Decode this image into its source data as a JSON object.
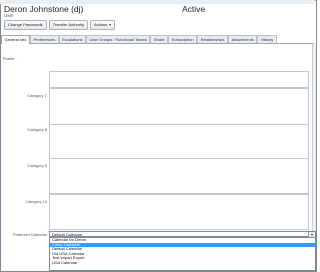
{
  "header": {
    "name": "Deron Johnstone (dj)",
    "role": "User",
    "status": "Active"
  },
  "toolbar": {
    "buttons": [
      {
        "label": "Change Passwords"
      },
      {
        "label": "Transfer Authority"
      },
      {
        "label": "Actions"
      }
    ]
  },
  "tabs": [
    {
      "label": "General Info",
      "active": true
    },
    {
      "label": "Preferences"
    },
    {
      "label": "Escalations"
    },
    {
      "label": "User Groups / Functional Teams"
    },
    {
      "label": "Share"
    },
    {
      "label": "Subscription"
    },
    {
      "label": "Relationships"
    },
    {
      "label": "Attachments"
    },
    {
      "label": "History"
    }
  ],
  "form": {
    "section_title": "Profile",
    "fields": [
      {
        "label": "Category 7"
      },
      {
        "label": "Category 8"
      },
      {
        "label": "Category 9"
      },
      {
        "label": "Category 10"
      }
    ],
    "preferred_calendar": {
      "label": "Preferred Calendar",
      "value": "Default Calendar",
      "options": [
        "Calendar for Deron",
        "China Calendar",
        "Default Calendar",
        "Old USA Calendar",
        "Test Import Export",
        "USA Calendar"
      ],
      "highlighted_index": 1
    }
  },
  "colors": {
    "accent": "#3399ff",
    "section_title": "#2a5c8a",
    "border": "#7f8a96"
  }
}
